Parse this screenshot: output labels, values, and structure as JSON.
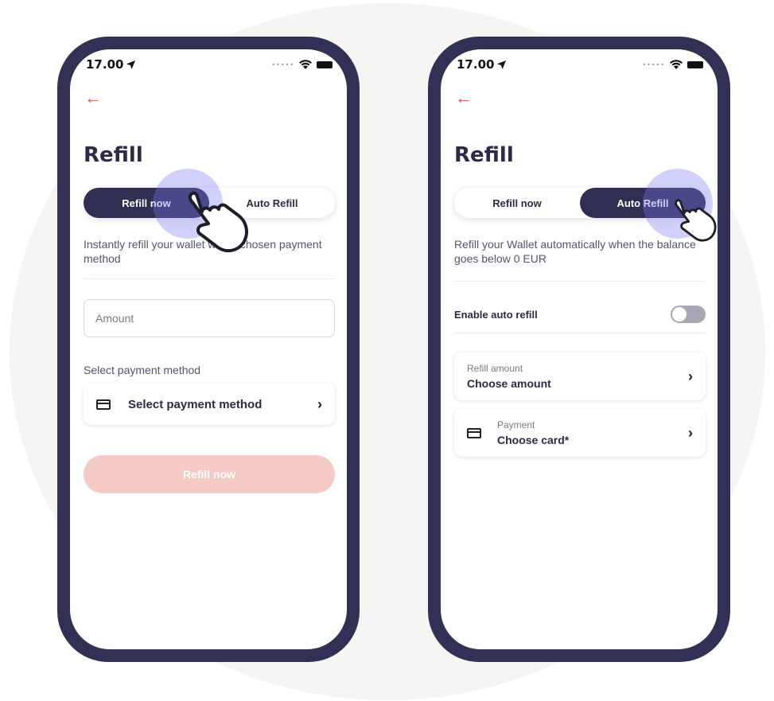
{
  "left_phone": {
    "status_time": "17.00",
    "title": "Refill",
    "tabs": [
      {
        "label": "Refill now",
        "active": true
      },
      {
        "label": "Auto Refill",
        "active": false
      }
    ],
    "description": "Instantly refill your wallet with a chosen payment method",
    "amount_placeholder": "Amount",
    "payment_section_label": "Select payment method",
    "payment_selector_label": "Select payment method",
    "submit_label": "Refill now"
  },
  "right_phone": {
    "status_time": "17.00",
    "title": "Refill",
    "tabs": [
      {
        "label": "Refill now",
        "active": false
      },
      {
        "label": "Auto Refill",
        "active": true
      }
    ],
    "description": "Refill your Wallet automatically when the balance goes below 0 EUR",
    "enable_label": "Enable auto refill",
    "enable_on": false,
    "refill_amount_label": "Refill amount",
    "refill_amount_value": "Choose amount",
    "payment_label": "Payment",
    "payment_value": "Choose card*"
  },
  "icons": [
    "back-arrow-icon",
    "location-arrow-icon",
    "wifi-icon",
    "battery-icon",
    "card-icon",
    "chevron-right-icon",
    "hand-pointer-icon"
  ],
  "colors": {
    "accent_red": "#e8554f",
    "navy": "#302e51",
    "frame": "#323054",
    "disabled_button": "#f5c9c4",
    "tap_halo": "#8b8bf2"
  }
}
